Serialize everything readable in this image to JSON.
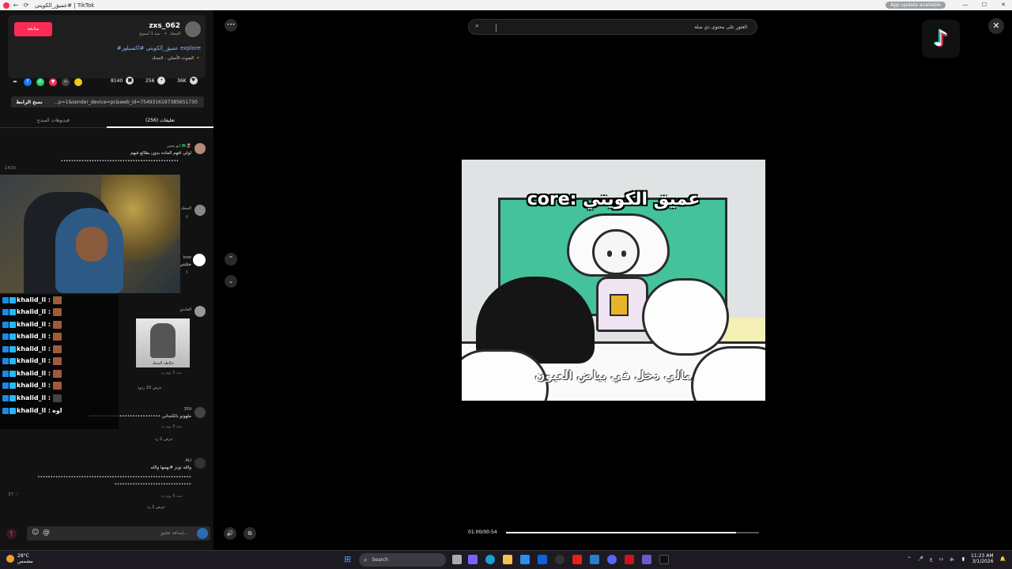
{
  "window": {
    "title": "عميق_الكويتي# | TikTok",
    "update_badge": "App update available",
    "ctrl_min": "—",
    "ctrl_max": "☐",
    "ctrl_close": "✕",
    "nav_back": "←",
    "nav_reload": "⟳"
  },
  "post": {
    "follow_label": "متابعة",
    "username": "zxs_062",
    "posted_meta": "المحك 🔸 · منذ 1 أسبوع",
    "hashtags": "#عميق_الكويتي #اكسبلور explore",
    "sound": "الصوت الأصلي - المحك 🔸"
  },
  "stats": {
    "likes": "36K",
    "comments": "256",
    "saves": "8140"
  },
  "share": {
    "copy_label": "نسخ الرابط",
    "link": "...p=1&sender_device=pc&web_id=7549316197385651730"
  },
  "tabs": {
    "comments": "تعليقات (256)",
    "creator_videos": "فيديوهات المبدع"
  },
  "comments": [
    {
      "name": "ابو يحيى 🇸🇦🌋",
      "text": "لولي افهم الماده بدون يطالع فيهم",
      "dots": "••••••••••••••••••••••••••••••••••••••••••••••",
      "likes": "1420"
    },
    {
      "name": "المحك",
      "text": "",
      "meta": "6"
    },
    {
      "name": "bow",
      "text": "ختايتي",
      "meta": "6"
    },
    {
      "name": "العابدي",
      "text": "",
      "meta": "منذ 5 يوم  رد",
      "replies": "عرض 10 ردود"
    },
    {
      "name": "359",
      "text": "•••••••••••••••••••••••••••• ملهونو بالكحناني",
      "meta": "منذ 6 يوم  رد",
      "replies": "عرض 1 رد"
    },
    {
      "name": "ALI",
      "text": "والله تونز #يهمها والله",
      "dots": "••••••••••••••••••••••••••••••••••••••••••••••••••••••••••••",
      "dots2": "••••••••••••••••••••••••••••••",
      "meta": "منذ 6 يوم  رد",
      "replies": "عرض 1 رد",
      "likes": "37 ♡"
    }
  ],
  "gift_caption": "خيّاطة المحك",
  "chat": {
    "user": "khalid_ll :",
    "last_message": "اوه"
  },
  "input": {
    "placeholder": "إضافة تعليق..."
  },
  "video": {
    "search_text": "العثور على محتوى ذي صلة",
    "caption_top": "core: عميق الكويتي",
    "caption_bottom": "مالي دخل في بياض العيون",
    "time": "01:00/00:54",
    "progress": 0.91
  },
  "icons": {
    "more": "•••",
    "up": "⌃",
    "down": "⌄",
    "volume": "🔊",
    "close": "✕",
    "search": "⌕",
    "tiktok": "♪"
  },
  "taskbar": {
    "temp": "28°C",
    "condition": "مشمس",
    "search_label": "Search",
    "time": "11:23 AM",
    "date": "3/1/2026"
  },
  "colors": {
    "accent": "#fe2c55",
    "board": "#44c29b"
  }
}
